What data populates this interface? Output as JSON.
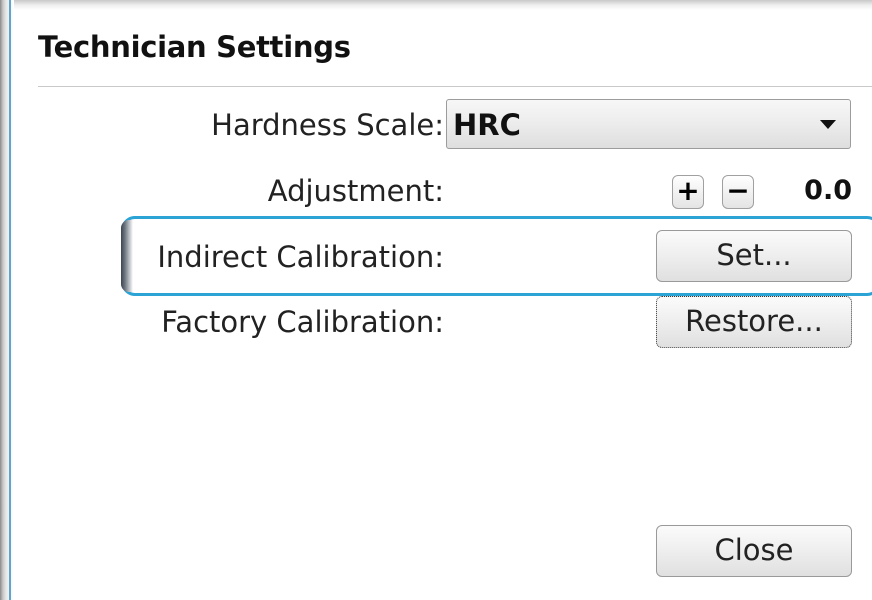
{
  "dialog": {
    "title": "Technician Settings"
  },
  "hardness_scale": {
    "label": "Hardness Scale:",
    "selected_value": "HRC"
  },
  "adjustment": {
    "label": "Adjustment:",
    "plus_symbol": "+",
    "minus_symbol": "−",
    "value": "0.0"
  },
  "indirect_calibration": {
    "label": "Indirect Calibration:",
    "button_label": "Set..."
  },
  "factory_calibration": {
    "label": "Factory Calibration:",
    "button_label": "Restore..."
  },
  "footer": {
    "close_label": "Close"
  },
  "colors": {
    "focus_border": "#2ba3d5",
    "window_edge": "#5fa6c9"
  },
  "icons": {
    "dropdown": "chevron-down-icon",
    "increment": "plus-icon",
    "decrement": "minus-icon"
  }
}
